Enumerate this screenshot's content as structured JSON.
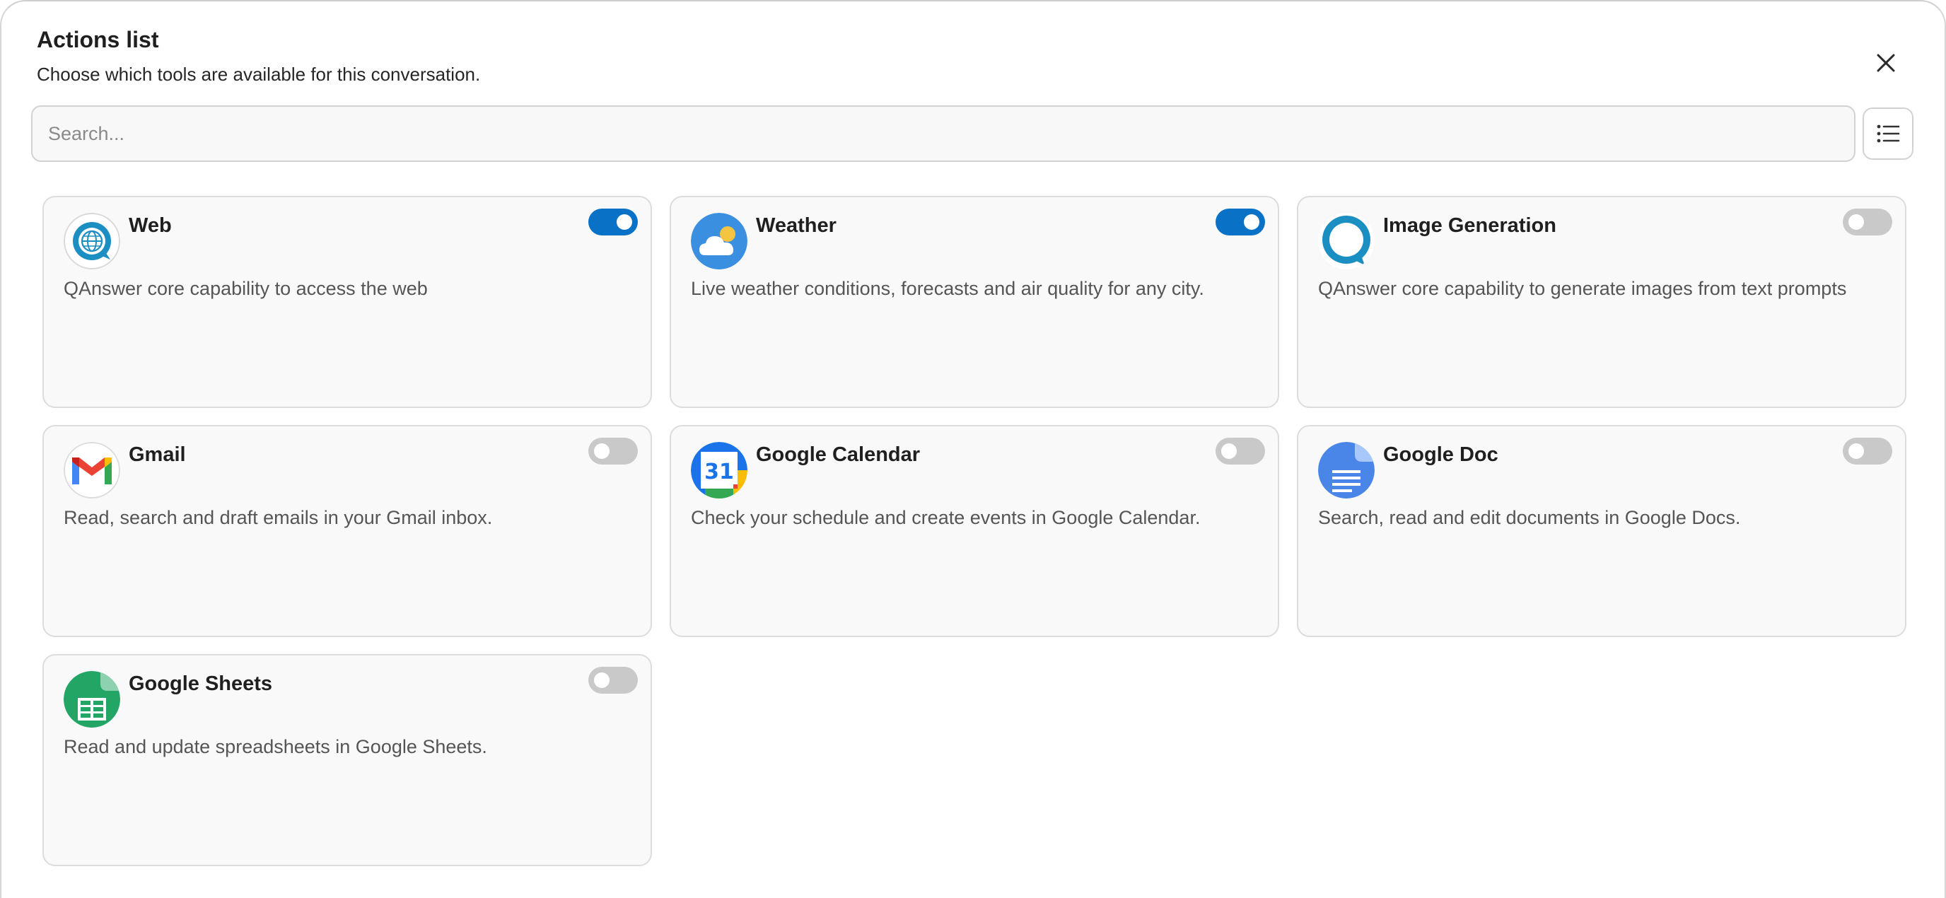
{
  "header": {
    "title": "Actions list",
    "subtitle": "Choose which tools are available for this conversation."
  },
  "search": {
    "placeholder": "Search...",
    "value": ""
  },
  "colors": {
    "toggle_on": "#0a72c6",
    "toggle_off": "#c9c9c9"
  },
  "actions": [
    {
      "name": "Web",
      "description": "QAnswer core capability to access the web",
      "enabled": true,
      "icon": "globe-chat-icon"
    },
    {
      "name": "Weather",
      "description": "Live weather conditions, forecasts and air quality for any city.",
      "enabled": true,
      "icon": "weather-cloud-icon"
    },
    {
      "name": "Image Generation",
      "description": "QAnswer core capability to generate images from text prompts",
      "enabled": false,
      "icon": "chat-bubble-icon"
    },
    {
      "name": "Gmail",
      "description": "Read, search and draft emails in your Gmail inbox.",
      "enabled": false,
      "icon": "gmail-icon"
    },
    {
      "name": "Google Calendar",
      "description": "Check your schedule and create events in Google Calendar.",
      "enabled": false,
      "icon": "google-calendar-icon",
      "icon_text": "31"
    },
    {
      "name": "Google Doc",
      "description": "Search, read and edit documents in Google Docs.",
      "enabled": false,
      "icon": "google-doc-icon"
    },
    {
      "name": "Google Sheets",
      "description": "Read and update spreadsheets in Google Sheets.",
      "enabled": false,
      "icon": "google-sheets-icon"
    }
  ]
}
